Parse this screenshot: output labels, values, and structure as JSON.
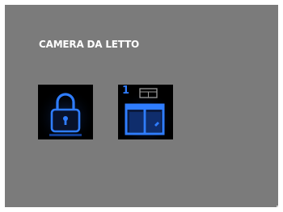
{
  "room": {
    "title": "CAMERA DA LETTO"
  },
  "tiles": [
    {
      "icon": "padlock-icon",
      "accent": "#1f6bff"
    },
    {
      "icon": "window-shutter-icon",
      "number": "1",
      "accent": "#1f6bff"
    }
  ],
  "colors": {
    "background": "#7b7b7b",
    "tile": "#000000",
    "accent": "#1f6bff",
    "title": "#ffffff"
  }
}
